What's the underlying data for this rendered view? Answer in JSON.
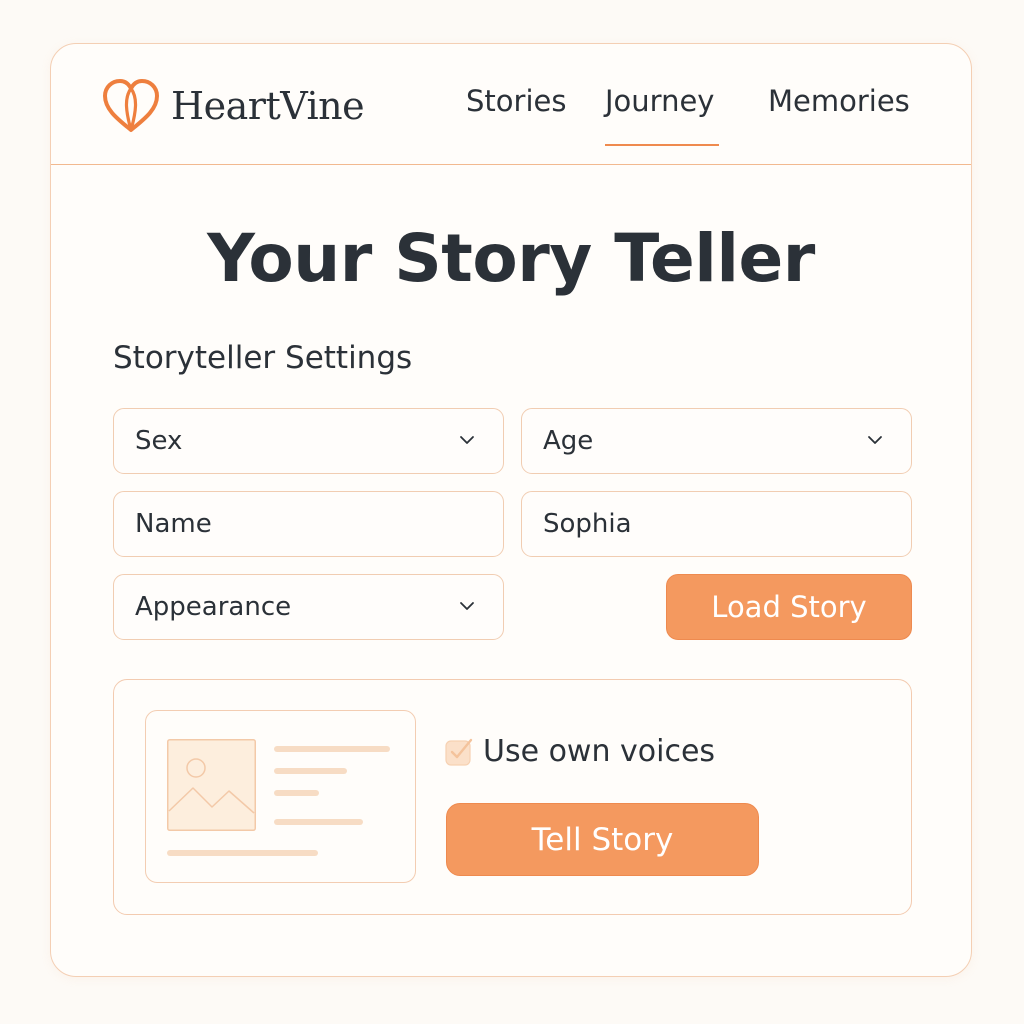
{
  "app": {
    "name": "HeartVine",
    "logo_icon": "heart-logo-icon"
  },
  "nav": {
    "items": [
      {
        "label": "Stories",
        "active": false
      },
      {
        "label": "Journey",
        "active": true
      },
      {
        "label": "Memories",
        "active": false
      }
    ]
  },
  "main": {
    "title": "Your Story Teller",
    "settings_title": "Storyteller Settings",
    "fields": {
      "sex": {
        "placeholder": "Sex",
        "type": "select"
      },
      "age": {
        "placeholder": "Age",
        "type": "select"
      },
      "name": {
        "placeholder": "Name",
        "type": "text"
      },
      "sophia": {
        "value": "Sophia",
        "type": "text"
      },
      "appearance": {
        "placeholder": "Appearance",
        "type": "select"
      }
    },
    "load_button": "Load Story"
  },
  "story_panel": {
    "preview_icon": "image-placeholder-icon",
    "use_own_voices": {
      "label": "Use own voices",
      "checked": true
    },
    "tell_button": "Tell Story"
  },
  "colors": {
    "accent": "#f4995f",
    "accent_border": "#ee8a4f",
    "nav_underline": "#ef8a4e",
    "field_border": "#f1cdb2",
    "text": "#2b3138",
    "background": "#fdfaf6"
  }
}
